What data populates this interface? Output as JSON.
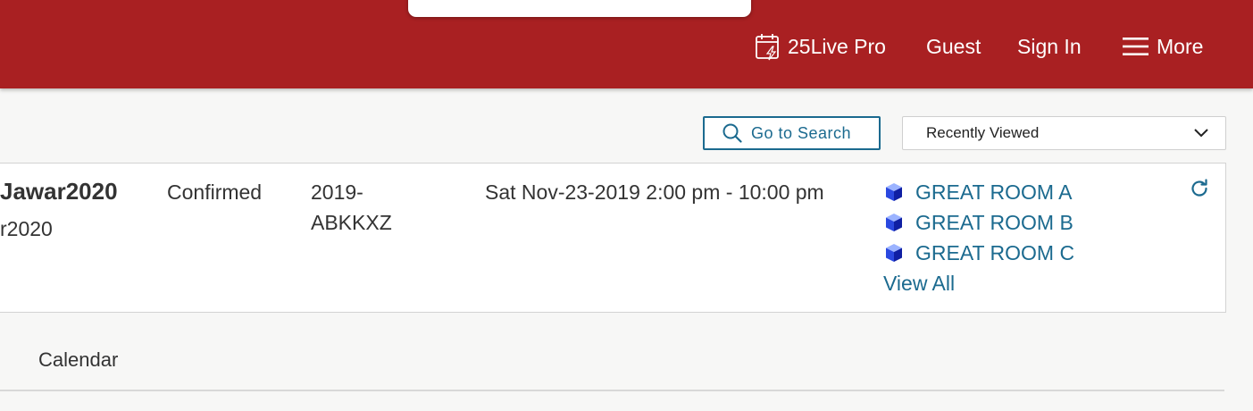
{
  "header": {
    "product_label": "25Live Pro",
    "guest_label": "Guest",
    "signin_label": "Sign In",
    "more_label": "More",
    "color": "#a92022",
    "icons": {
      "product": "calendar-bolt-icon",
      "more": "hamburger-menu-icon"
    }
  },
  "toolbar": {
    "search_button_label": "Go to Search",
    "search_icon": "search-icon",
    "select_value": "Recently Viewed"
  },
  "event": {
    "name": "Jawar2020",
    "subtitle": "r2020",
    "state": "Confirmed",
    "reference": "2019-ABKKXZ",
    "date_time": "Sat Nov-23-2019 2:00 pm - 10:00 pm",
    "locations": [
      "GREAT ROOM A",
      "GREAT ROOM B",
      "GREAT ROOM C"
    ],
    "view_all_label": "View All",
    "location_icon": "cube-icon",
    "refresh_icon": "refresh-icon"
  },
  "section": {
    "calendar_label": "Calendar"
  },
  "colors": {
    "link": "#1b6a8f",
    "background": "#f7f7f6"
  }
}
